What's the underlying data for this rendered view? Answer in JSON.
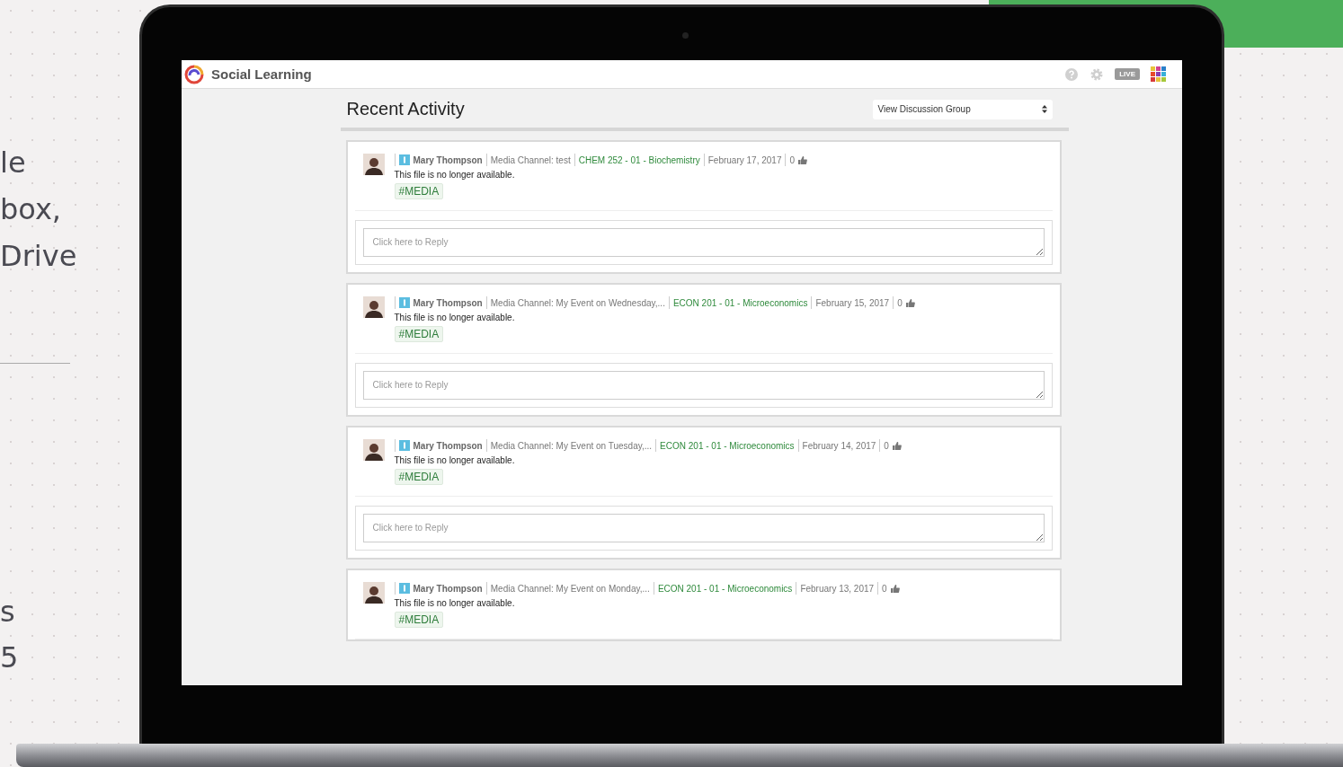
{
  "backdrop_text": [
    "le",
    "box,",
    "Drive",
    "s",
    "5"
  ],
  "app": {
    "title": "Social Learning",
    "live_badge": "LIVE"
  },
  "page": {
    "title": "Recent Activity",
    "group_select": {
      "value": "View Discussion Group"
    }
  },
  "posts": [
    {
      "author": "Mary Thompson",
      "channel": "Media Channel: test",
      "course": "CHEM 252 - 01 - Biochemistry",
      "date": "February 17, 2017",
      "likes": "0",
      "message": "This file is no longer available.",
      "tag": "#MEDIA",
      "reply": {
        "placeholder": "Click here to Reply"
      }
    },
    {
      "author": "Mary Thompson",
      "channel": "Media Channel: My Event on Wednesday,...",
      "course": "ECON 201 - 01 - Microeconomics",
      "date": "February 15, 2017",
      "likes": "0",
      "message": "This file is no longer available.",
      "tag": "#MEDIA",
      "reply": {
        "placeholder": "Click here to Reply"
      }
    },
    {
      "author": "Mary Thompson",
      "channel": "Media Channel: My Event on Tuesday,...",
      "course": "ECON 201 - 01 - Microeconomics",
      "date": "February 14, 2017",
      "likes": "0",
      "message": "This file is no longer available.",
      "tag": "#MEDIA",
      "reply": {
        "placeholder": "Click here to Reply"
      }
    },
    {
      "author": "Mary Thompson",
      "channel": "Media Channel: My Event on Monday,...",
      "course": "ECON 201 - 01 - Microeconomics",
      "date": "February 13, 2017",
      "likes": "0",
      "message": "This file is no longer available.",
      "tag": "#MEDIA"
    }
  ]
}
